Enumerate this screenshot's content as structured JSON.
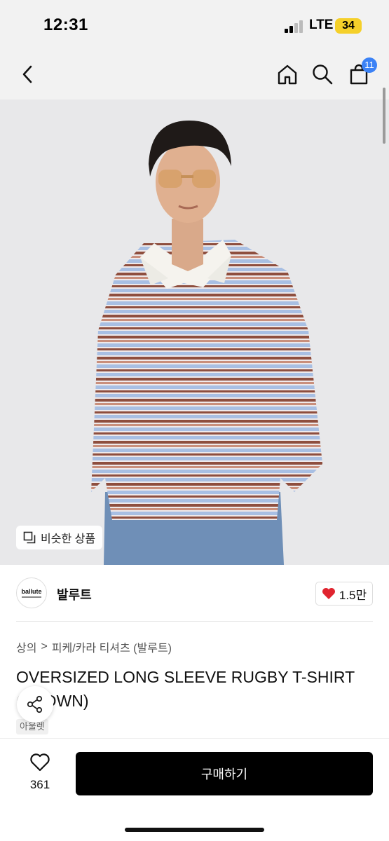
{
  "status_bar": {
    "time": "12:31",
    "network": "LTE",
    "battery": "34"
  },
  "nav": {
    "back_icon": "chevron-left-icon",
    "home_icon": "home-icon",
    "search_icon": "search-icon",
    "cart_icon": "shopping-bag-icon",
    "cart_badge": "11"
  },
  "product_image": {
    "description_icon": "model-photo",
    "similar_label": "비슷한 상품"
  },
  "seller": {
    "logo_text": "ballute",
    "name": "발루트",
    "likes": "1.5만"
  },
  "breadcrumb": {
    "category": "상의",
    "separator": ">",
    "subcategory": "피케/카라 티셔츠 (발루트)"
  },
  "product": {
    "title": "OVERSIZED LONG SLEEVE RUGBY T-SHIRT (BROWN)",
    "brand_tag": "아울렛"
  },
  "bottom_bar": {
    "wish_count": "361",
    "buy_label": "구매하기"
  },
  "colors": {
    "accent": "#3b82f6",
    "battery": "#f5d02a",
    "heart": "#e0242f",
    "buy_button": "#000000"
  }
}
